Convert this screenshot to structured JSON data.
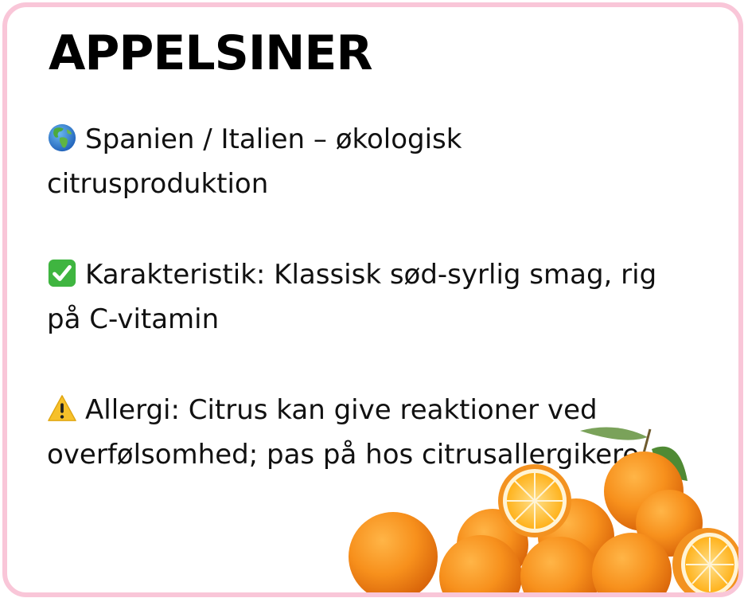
{
  "card": {
    "title": "APPELSINER",
    "origin": {
      "icon": "globe-europe-africa-icon",
      "text": "Spanien / Italien – økologisk citrusproduktion"
    },
    "characteristic": {
      "icon": "check-mark-button-icon",
      "text": "Karakteristik: Klassisk sød-syrlig smag, rig på C-vitamin"
    },
    "allergy": {
      "icon": "warning-icon",
      "text": "Allergi: Citrus kan give reaktioner ved overfølsomhed; pas på hos citrusallergikere"
    },
    "image": "oranges-illustration"
  },
  "colors": {
    "border": "#f9c6d8",
    "title": "#000000",
    "text": "#111111",
    "orange": "#f28a1a"
  }
}
